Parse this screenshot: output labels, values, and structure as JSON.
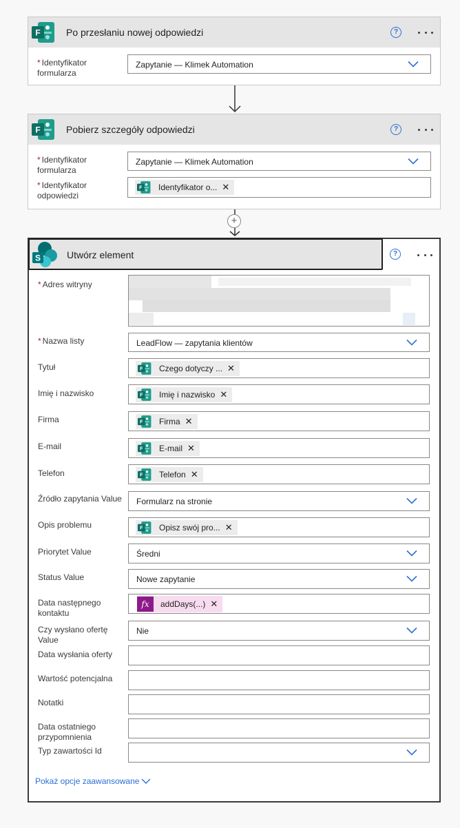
{
  "card1": {
    "title": "Po przesłaniu nowej odpowiedzi",
    "help_glyph": "?",
    "fields": [
      {
        "required_mark": "*",
        "label": "Identyfikator formularza",
        "value": "Zapytanie — Klimek Automation"
      }
    ]
  },
  "card2": {
    "title": "Pobierz szczegóły odpowiedzi",
    "help_glyph": "?",
    "fields": [
      {
        "required_mark": "*",
        "label": "Identyfikator formularza",
        "value": "Zapytanie — Klimek Automation"
      },
      {
        "required_mark": "*",
        "label": "Identyfikator odpowiedzi",
        "token": "Identyfikator o..."
      }
    ]
  },
  "connector": {
    "plus_glyph": "+"
  },
  "card3": {
    "title": "Utwórz element",
    "help_glyph": "?",
    "site_address": {
      "required_mark": "*",
      "label": "Adres witryny"
    },
    "list_name": {
      "required_mark": "*",
      "label": "Nazwa listy",
      "value": "LeadFlow — zapytania klientów"
    },
    "fields": [
      {
        "label": "Tytuł",
        "token": "Czego dotyczy ..."
      },
      {
        "label": "Imię i nazwisko",
        "token": "Imię i nazwisko"
      },
      {
        "label": "Firma",
        "token": "Firma"
      },
      {
        "label": "E-mail",
        "token": "E-mail"
      },
      {
        "label": "Telefon",
        "token": "Telefon"
      },
      {
        "label": "Źródło zapytania Value",
        "value": "Formularz na stronie"
      },
      {
        "label": "Opis problemu",
        "token": "Opisz swój pro..."
      },
      {
        "label": "Priorytet Value",
        "value": "Średni"
      },
      {
        "label": "Status Value",
        "value": "Nowe zapytanie"
      },
      {
        "label": "Data następnego kontaktu",
        "fx_token": "addDays(...)",
        "fx_glyph": "fx"
      },
      {
        "label": "Czy wysłano ofertę Value",
        "value": "Nie"
      },
      {
        "label": "Data wysłania oferty",
        "value": ""
      },
      {
        "label": "Wartość potencjalna",
        "value": ""
      },
      {
        "label": "Notatki",
        "value": ""
      },
      {
        "label": "Data ostatniego przypomnienia",
        "value": ""
      },
      {
        "label": "Typ zawartości Id",
        "value": ""
      }
    ],
    "advanced_link": "Pokaż opcje zaawansowane"
  },
  "token_close_glyph": "✕",
  "colors": {
    "accent": "#2b6fd6",
    "required": "#a4262c",
    "forms_teal": "#0f7b6c",
    "sharepoint_teal": "#038387",
    "fx_purple": "#8c1a8a"
  },
  "icons": [
    "forms-app-icon",
    "sharepoint-app-icon",
    "help-icon",
    "more-options-icon",
    "chevron-down-icon",
    "close-icon",
    "add-step-icon",
    "expression-icon"
  ]
}
